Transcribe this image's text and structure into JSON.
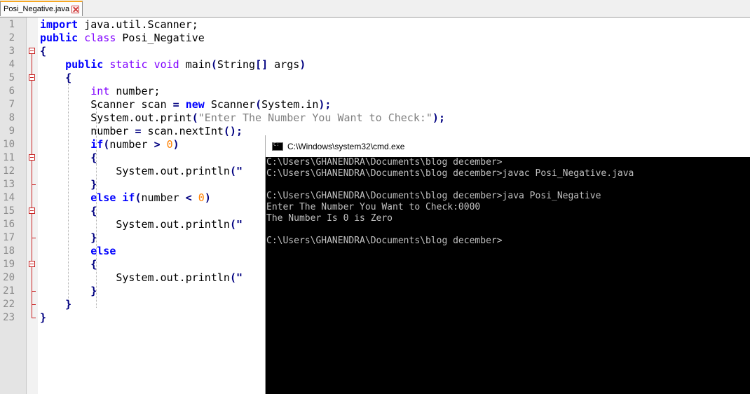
{
  "editor": {
    "tab": {
      "label": "Posi_Negative.java"
    },
    "line_numbers": [
      "1",
      "2",
      "3",
      "4",
      "5",
      "6",
      "7",
      "8",
      "9",
      "10",
      "11",
      "12",
      "13",
      "14",
      "15",
      "16",
      "17",
      "18",
      "19",
      "20",
      "21",
      "22",
      "23"
    ],
    "code": [
      [
        {
          "t": "import",
          "c": "kw"
        },
        {
          "t": " java.util.Scanner;",
          "c": ""
        }
      ],
      [
        {
          "t": "public",
          "c": "kw"
        },
        {
          "t": " ",
          "c": ""
        },
        {
          "t": "class",
          "c": "kw2"
        },
        {
          "t": " Posi_Negative",
          "c": ""
        }
      ],
      [
        {
          "t": "{",
          "c": "op"
        }
      ],
      [
        {
          "t": "    ",
          "c": ""
        },
        {
          "t": "public",
          "c": "kw"
        },
        {
          "t": " ",
          "c": ""
        },
        {
          "t": "static",
          "c": "kw2"
        },
        {
          "t": " ",
          "c": ""
        },
        {
          "t": "void",
          "c": "kw2"
        },
        {
          "t": " main",
          "c": ""
        },
        {
          "t": "(",
          "c": "op"
        },
        {
          "t": "String",
          "c": ""
        },
        {
          "t": "[]",
          "c": "op"
        },
        {
          "t": " args",
          "c": ""
        },
        {
          "t": ")",
          "c": "op"
        }
      ],
      [
        {
          "t": "    ",
          "c": ""
        },
        {
          "t": "{",
          "c": "op"
        }
      ],
      [
        {
          "t": "        ",
          "c": ""
        },
        {
          "t": "int",
          "c": "kw2"
        },
        {
          "t": " number;",
          "c": ""
        }
      ],
      [
        {
          "t": "        Scanner scan ",
          "c": ""
        },
        {
          "t": "=",
          "c": "op"
        },
        {
          "t": " ",
          "c": ""
        },
        {
          "t": "new",
          "c": "kw"
        },
        {
          "t": " Scanner",
          "c": ""
        },
        {
          "t": "(",
          "c": "op"
        },
        {
          "t": "System.in",
          "c": ""
        },
        {
          "t": ");",
          "c": "op"
        }
      ],
      [
        {
          "t": "        System.out.print",
          "c": ""
        },
        {
          "t": "(",
          "c": "op"
        },
        {
          "t": "\"Enter The Number You Want to Check:\"",
          "c": "str"
        },
        {
          "t": ");",
          "c": "op"
        }
      ],
      [
        {
          "t": "        number ",
          "c": ""
        },
        {
          "t": "=",
          "c": "op"
        },
        {
          "t": " scan.nextInt",
          "c": ""
        },
        {
          "t": "();",
          "c": "op"
        }
      ],
      [
        {
          "t": "        ",
          "c": ""
        },
        {
          "t": "if",
          "c": "kw"
        },
        {
          "t": "(",
          "c": "op"
        },
        {
          "t": "number ",
          "c": ""
        },
        {
          "t": ">",
          "c": "op"
        },
        {
          "t": " ",
          "c": ""
        },
        {
          "t": "0",
          "c": "num"
        },
        {
          "t": ")",
          "c": "op"
        }
      ],
      [
        {
          "t": "        ",
          "c": ""
        },
        {
          "t": "{",
          "c": "op"
        }
      ],
      [
        {
          "t": "            System.out.println",
          "c": ""
        },
        {
          "t": "(\"",
          "c": "op"
        }
      ],
      [
        {
          "t": "        ",
          "c": ""
        },
        {
          "t": "}",
          "c": "op"
        }
      ],
      [
        {
          "t": "        ",
          "c": ""
        },
        {
          "t": "else",
          "c": "kw"
        },
        {
          "t": " ",
          "c": ""
        },
        {
          "t": "if",
          "c": "kw"
        },
        {
          "t": "(",
          "c": "op"
        },
        {
          "t": "number ",
          "c": ""
        },
        {
          "t": "<",
          "c": "op"
        },
        {
          "t": " ",
          "c": ""
        },
        {
          "t": "0",
          "c": "num"
        },
        {
          "t": ")",
          "c": "op"
        }
      ],
      [
        {
          "t": "        ",
          "c": ""
        },
        {
          "t": "{",
          "c": "op"
        }
      ],
      [
        {
          "t": "            System.out.println",
          "c": ""
        },
        {
          "t": "(\"",
          "c": "op"
        }
      ],
      [
        {
          "t": "        ",
          "c": ""
        },
        {
          "t": "}",
          "c": "op"
        }
      ],
      [
        {
          "t": "        ",
          "c": ""
        },
        {
          "t": "else",
          "c": "kw"
        }
      ],
      [
        {
          "t": "        ",
          "c": ""
        },
        {
          "t": "{",
          "c": "op"
        }
      ],
      [
        {
          "t": "            System.out.println",
          "c": ""
        },
        {
          "t": "(\"",
          "c": "op"
        }
      ],
      [
        {
          "t": "        ",
          "c": ""
        },
        {
          "t": "}",
          "c": "op"
        }
      ],
      [
        {
          "t": "    ",
          "c": ""
        },
        {
          "t": "}",
          "c": "op"
        }
      ],
      [
        {
          "t": "}",
          "c": "op"
        }
      ]
    ]
  },
  "cmd": {
    "title": "C:\\Windows\\system32\\cmd.exe",
    "lines": [
      "C:\\Users\\GHANENDRA\\Documents\\blog december>",
      "C:\\Users\\GHANENDRA\\Documents\\blog december>javac Posi_Negative.java",
      "",
      "C:\\Users\\GHANENDRA\\Documents\\blog december>java Posi_Negative",
      "Enter The Number You Want to Check:0000",
      "The Number Is 0 is Zero",
      "",
      "C:\\Users\\GHANENDRA\\Documents\\blog december>"
    ]
  }
}
